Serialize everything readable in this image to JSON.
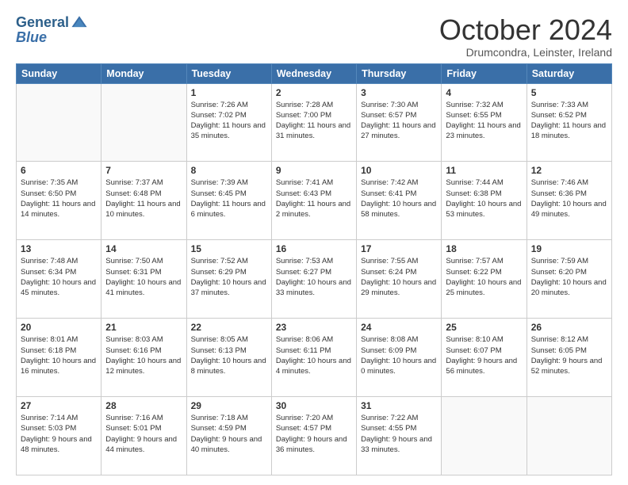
{
  "logo": {
    "line1": "General",
    "line2": "Blue"
  },
  "header": {
    "month": "October 2024",
    "location": "Drumcondra, Leinster, Ireland"
  },
  "weekdays": [
    "Sunday",
    "Monday",
    "Tuesday",
    "Wednesday",
    "Thursday",
    "Friday",
    "Saturday"
  ],
  "weeks": [
    [
      {
        "day": "",
        "info": ""
      },
      {
        "day": "",
        "info": ""
      },
      {
        "day": "1",
        "info": "Sunrise: 7:26 AM\nSunset: 7:02 PM\nDaylight: 11 hours and 35 minutes."
      },
      {
        "day": "2",
        "info": "Sunrise: 7:28 AM\nSunset: 7:00 PM\nDaylight: 11 hours and 31 minutes."
      },
      {
        "day": "3",
        "info": "Sunrise: 7:30 AM\nSunset: 6:57 PM\nDaylight: 11 hours and 27 minutes."
      },
      {
        "day": "4",
        "info": "Sunrise: 7:32 AM\nSunset: 6:55 PM\nDaylight: 11 hours and 23 minutes."
      },
      {
        "day": "5",
        "info": "Sunrise: 7:33 AM\nSunset: 6:52 PM\nDaylight: 11 hours and 18 minutes."
      }
    ],
    [
      {
        "day": "6",
        "info": "Sunrise: 7:35 AM\nSunset: 6:50 PM\nDaylight: 11 hours and 14 minutes."
      },
      {
        "day": "7",
        "info": "Sunrise: 7:37 AM\nSunset: 6:48 PM\nDaylight: 11 hours and 10 minutes."
      },
      {
        "day": "8",
        "info": "Sunrise: 7:39 AM\nSunset: 6:45 PM\nDaylight: 11 hours and 6 minutes."
      },
      {
        "day": "9",
        "info": "Sunrise: 7:41 AM\nSunset: 6:43 PM\nDaylight: 11 hours and 2 minutes."
      },
      {
        "day": "10",
        "info": "Sunrise: 7:42 AM\nSunset: 6:41 PM\nDaylight: 10 hours and 58 minutes."
      },
      {
        "day": "11",
        "info": "Sunrise: 7:44 AM\nSunset: 6:38 PM\nDaylight: 10 hours and 53 minutes."
      },
      {
        "day": "12",
        "info": "Sunrise: 7:46 AM\nSunset: 6:36 PM\nDaylight: 10 hours and 49 minutes."
      }
    ],
    [
      {
        "day": "13",
        "info": "Sunrise: 7:48 AM\nSunset: 6:34 PM\nDaylight: 10 hours and 45 minutes."
      },
      {
        "day": "14",
        "info": "Sunrise: 7:50 AM\nSunset: 6:31 PM\nDaylight: 10 hours and 41 minutes."
      },
      {
        "day": "15",
        "info": "Sunrise: 7:52 AM\nSunset: 6:29 PM\nDaylight: 10 hours and 37 minutes."
      },
      {
        "day": "16",
        "info": "Sunrise: 7:53 AM\nSunset: 6:27 PM\nDaylight: 10 hours and 33 minutes."
      },
      {
        "day": "17",
        "info": "Sunrise: 7:55 AM\nSunset: 6:24 PM\nDaylight: 10 hours and 29 minutes."
      },
      {
        "day": "18",
        "info": "Sunrise: 7:57 AM\nSunset: 6:22 PM\nDaylight: 10 hours and 25 minutes."
      },
      {
        "day": "19",
        "info": "Sunrise: 7:59 AM\nSunset: 6:20 PM\nDaylight: 10 hours and 20 minutes."
      }
    ],
    [
      {
        "day": "20",
        "info": "Sunrise: 8:01 AM\nSunset: 6:18 PM\nDaylight: 10 hours and 16 minutes."
      },
      {
        "day": "21",
        "info": "Sunrise: 8:03 AM\nSunset: 6:16 PM\nDaylight: 10 hours and 12 minutes."
      },
      {
        "day": "22",
        "info": "Sunrise: 8:05 AM\nSunset: 6:13 PM\nDaylight: 10 hours and 8 minutes."
      },
      {
        "day": "23",
        "info": "Sunrise: 8:06 AM\nSunset: 6:11 PM\nDaylight: 10 hours and 4 minutes."
      },
      {
        "day": "24",
        "info": "Sunrise: 8:08 AM\nSunset: 6:09 PM\nDaylight: 10 hours and 0 minutes."
      },
      {
        "day": "25",
        "info": "Sunrise: 8:10 AM\nSunset: 6:07 PM\nDaylight: 9 hours and 56 minutes."
      },
      {
        "day": "26",
        "info": "Sunrise: 8:12 AM\nSunset: 6:05 PM\nDaylight: 9 hours and 52 minutes."
      }
    ],
    [
      {
        "day": "27",
        "info": "Sunrise: 7:14 AM\nSunset: 5:03 PM\nDaylight: 9 hours and 48 minutes."
      },
      {
        "day": "28",
        "info": "Sunrise: 7:16 AM\nSunset: 5:01 PM\nDaylight: 9 hours and 44 minutes."
      },
      {
        "day": "29",
        "info": "Sunrise: 7:18 AM\nSunset: 4:59 PM\nDaylight: 9 hours and 40 minutes."
      },
      {
        "day": "30",
        "info": "Sunrise: 7:20 AM\nSunset: 4:57 PM\nDaylight: 9 hours and 36 minutes."
      },
      {
        "day": "31",
        "info": "Sunrise: 7:22 AM\nSunset: 4:55 PM\nDaylight: 9 hours and 33 minutes."
      },
      {
        "day": "",
        "info": ""
      },
      {
        "day": "",
        "info": ""
      }
    ]
  ]
}
